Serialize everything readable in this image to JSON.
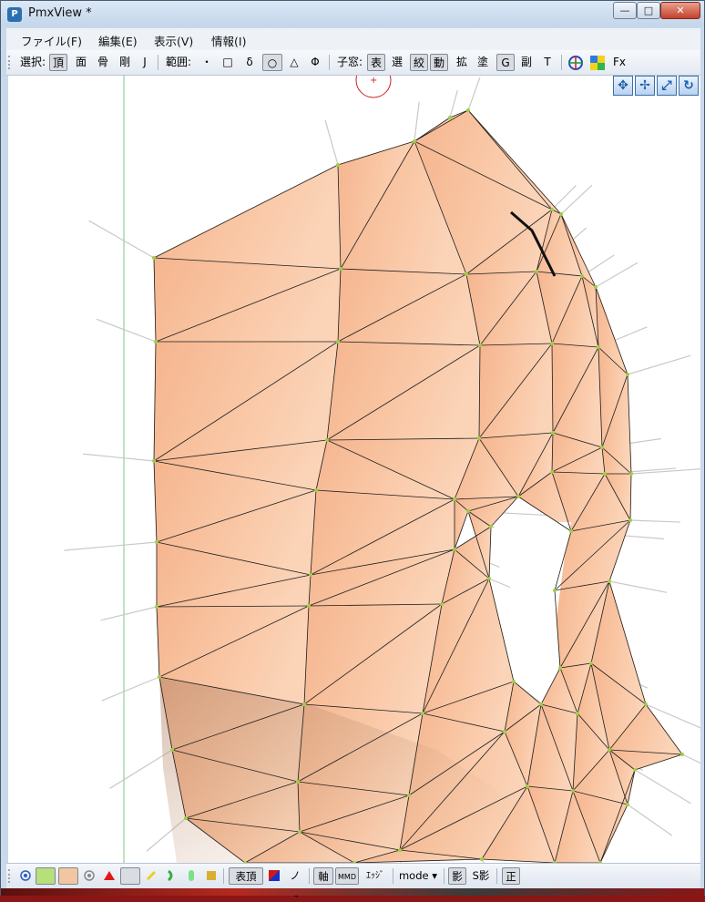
{
  "window": {
    "title": "PmxView *",
    "app_icon_glyph": "P",
    "controls": {
      "minimize": "—",
      "maximize": "□",
      "close": "✕"
    }
  },
  "menu": {
    "file": "ファイル(F)",
    "edit": "編集(E)",
    "view": "表示(V)",
    "info": "情報(I)"
  },
  "toolbar": {
    "select_label": "選択:",
    "select_vertex": "頂",
    "select_face": "面",
    "select_bone": "骨",
    "select_rigid": "剛",
    "select_joint": "J",
    "range_label": "範囲:",
    "range_dot": "・",
    "range_square": "□",
    "range_delta": "δ",
    "range_circle": "○",
    "range_triangle": "△",
    "range_phi": "Φ",
    "child_label": "子窓:",
    "child_show": "表",
    "child_select": "選",
    "child_narrow": "絞",
    "child_move": "動",
    "child_scale": "拡",
    "child_paint": "塗",
    "child_g": "G",
    "child_sub": "副",
    "child_t": "T",
    "fx": "Fx"
  },
  "status": {
    "show_vertex": "表頂",
    "nomi": "ノミ",
    "axis": "軸",
    "mmd": "MMD",
    "edge": "ｴｯｼﾞ",
    "mode": "mode ▾",
    "shadow": "影",
    "s_shadow": "S影",
    "correct": "正"
  },
  "icons": {
    "crosshair": "#1c4fb8",
    "mesh_face": "#f5c7a3",
    "vertex": "#9bd13f",
    "wire": "#1e1e1e",
    "guide": "#7fc47f"
  }
}
